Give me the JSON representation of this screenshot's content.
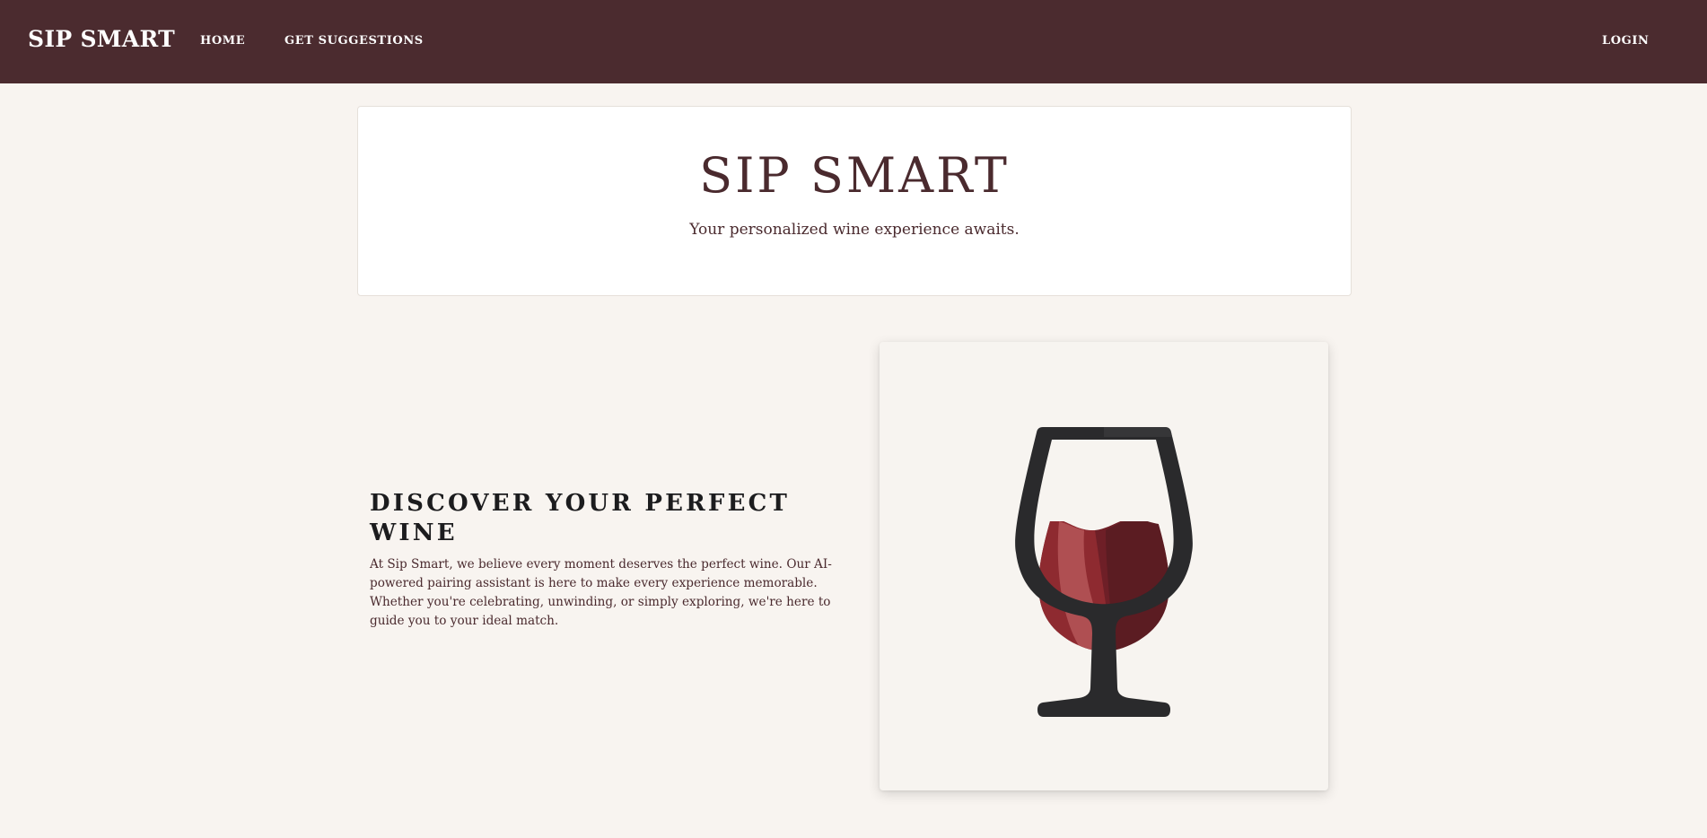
{
  "nav": {
    "brand": "SIP SMART",
    "links": [
      {
        "label": "HOME"
      },
      {
        "label": "GET SUGGESTIONS"
      }
    ],
    "login_label": "LOGIN"
  },
  "hero": {
    "title": "SIP SMART",
    "subtitle": "Your personalized wine experience awaits."
  },
  "about": {
    "heading": "DISCOVER YOUR PERFECT WINE",
    "body": "At Sip Smart, we believe every moment deserves the perfect wine. Our AI-powered pairing assistant is here to make every experience memorable. Whether you're celebrating, unwinding, or simply exploring, we're here to guide you to your ideal match."
  },
  "illustration": {
    "icon": "wine-glass-icon",
    "wine_color": "#8e2a30"
  },
  "colors": {
    "navbar": "#4b2b2f",
    "page_background": "#f8f4f0",
    "accent_text": "#4a2a2e"
  }
}
